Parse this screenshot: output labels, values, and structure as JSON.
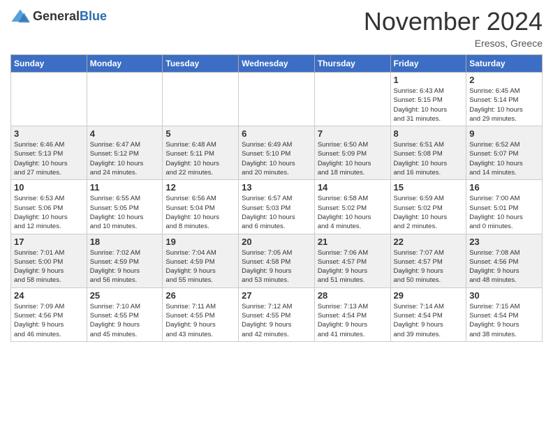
{
  "header": {
    "logo_general": "General",
    "logo_blue": "Blue",
    "month_title": "November 2024",
    "location": "Eresos, Greece"
  },
  "days_of_week": [
    "Sunday",
    "Monday",
    "Tuesday",
    "Wednesday",
    "Thursday",
    "Friday",
    "Saturday"
  ],
  "weeks": [
    [
      {
        "day": "",
        "info": ""
      },
      {
        "day": "",
        "info": ""
      },
      {
        "day": "",
        "info": ""
      },
      {
        "day": "",
        "info": ""
      },
      {
        "day": "",
        "info": ""
      },
      {
        "day": "1",
        "info": "Sunrise: 6:43 AM\nSunset: 5:15 PM\nDaylight: 10 hours\nand 31 minutes."
      },
      {
        "day": "2",
        "info": "Sunrise: 6:45 AM\nSunset: 5:14 PM\nDaylight: 10 hours\nand 29 minutes."
      }
    ],
    [
      {
        "day": "3",
        "info": "Sunrise: 6:46 AM\nSunset: 5:13 PM\nDaylight: 10 hours\nand 27 minutes."
      },
      {
        "day": "4",
        "info": "Sunrise: 6:47 AM\nSunset: 5:12 PM\nDaylight: 10 hours\nand 24 minutes."
      },
      {
        "day": "5",
        "info": "Sunrise: 6:48 AM\nSunset: 5:11 PM\nDaylight: 10 hours\nand 22 minutes."
      },
      {
        "day": "6",
        "info": "Sunrise: 6:49 AM\nSunset: 5:10 PM\nDaylight: 10 hours\nand 20 minutes."
      },
      {
        "day": "7",
        "info": "Sunrise: 6:50 AM\nSunset: 5:09 PM\nDaylight: 10 hours\nand 18 minutes."
      },
      {
        "day": "8",
        "info": "Sunrise: 6:51 AM\nSunset: 5:08 PM\nDaylight: 10 hours\nand 16 minutes."
      },
      {
        "day": "9",
        "info": "Sunrise: 6:52 AM\nSunset: 5:07 PM\nDaylight: 10 hours\nand 14 minutes."
      }
    ],
    [
      {
        "day": "10",
        "info": "Sunrise: 6:53 AM\nSunset: 5:06 PM\nDaylight: 10 hours\nand 12 minutes."
      },
      {
        "day": "11",
        "info": "Sunrise: 6:55 AM\nSunset: 5:05 PM\nDaylight: 10 hours\nand 10 minutes."
      },
      {
        "day": "12",
        "info": "Sunrise: 6:56 AM\nSunset: 5:04 PM\nDaylight: 10 hours\nand 8 minutes."
      },
      {
        "day": "13",
        "info": "Sunrise: 6:57 AM\nSunset: 5:03 PM\nDaylight: 10 hours\nand 6 minutes."
      },
      {
        "day": "14",
        "info": "Sunrise: 6:58 AM\nSunset: 5:02 PM\nDaylight: 10 hours\nand 4 minutes."
      },
      {
        "day": "15",
        "info": "Sunrise: 6:59 AM\nSunset: 5:02 PM\nDaylight: 10 hours\nand 2 minutes."
      },
      {
        "day": "16",
        "info": "Sunrise: 7:00 AM\nSunset: 5:01 PM\nDaylight: 10 hours\nand 0 minutes."
      }
    ],
    [
      {
        "day": "17",
        "info": "Sunrise: 7:01 AM\nSunset: 5:00 PM\nDaylight: 9 hours\nand 58 minutes."
      },
      {
        "day": "18",
        "info": "Sunrise: 7:02 AM\nSunset: 4:59 PM\nDaylight: 9 hours\nand 56 minutes."
      },
      {
        "day": "19",
        "info": "Sunrise: 7:04 AM\nSunset: 4:59 PM\nDaylight: 9 hours\nand 55 minutes."
      },
      {
        "day": "20",
        "info": "Sunrise: 7:05 AM\nSunset: 4:58 PM\nDaylight: 9 hours\nand 53 minutes."
      },
      {
        "day": "21",
        "info": "Sunrise: 7:06 AM\nSunset: 4:57 PM\nDaylight: 9 hours\nand 51 minutes."
      },
      {
        "day": "22",
        "info": "Sunrise: 7:07 AM\nSunset: 4:57 PM\nDaylight: 9 hours\nand 50 minutes."
      },
      {
        "day": "23",
        "info": "Sunrise: 7:08 AM\nSunset: 4:56 PM\nDaylight: 9 hours\nand 48 minutes."
      }
    ],
    [
      {
        "day": "24",
        "info": "Sunrise: 7:09 AM\nSunset: 4:56 PM\nDaylight: 9 hours\nand 46 minutes."
      },
      {
        "day": "25",
        "info": "Sunrise: 7:10 AM\nSunset: 4:55 PM\nDaylight: 9 hours\nand 45 minutes."
      },
      {
        "day": "26",
        "info": "Sunrise: 7:11 AM\nSunset: 4:55 PM\nDaylight: 9 hours\nand 43 minutes."
      },
      {
        "day": "27",
        "info": "Sunrise: 7:12 AM\nSunset: 4:55 PM\nDaylight: 9 hours\nand 42 minutes."
      },
      {
        "day": "28",
        "info": "Sunrise: 7:13 AM\nSunset: 4:54 PM\nDaylight: 9 hours\nand 41 minutes."
      },
      {
        "day": "29",
        "info": "Sunrise: 7:14 AM\nSunset: 4:54 PM\nDaylight: 9 hours\nand 39 minutes."
      },
      {
        "day": "30",
        "info": "Sunrise: 7:15 AM\nSunset: 4:54 PM\nDaylight: 9 hours\nand 38 minutes."
      }
    ]
  ]
}
